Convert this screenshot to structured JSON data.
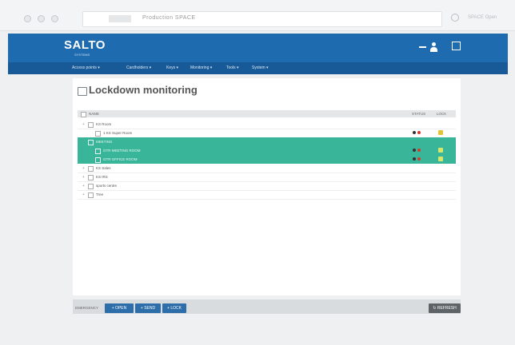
{
  "browser": {
    "url_text": "Production SPACE",
    "right_label": "SPACE Open",
    "gear_icon": "gear-icon"
  },
  "header": {
    "logo": "SALTO",
    "logo_sub": "SYSTEMS",
    "icons": [
      "minus-icon",
      "user-icon",
      "logout-icon"
    ],
    "brand_color": "#1e6bb0"
  },
  "nav": {
    "items": [
      "Access points ▾",
      "Cardholders ▾",
      "Keys ▾",
      "Monitoring ▾",
      "Tools ▾",
      "System ▾"
    ]
  },
  "page": {
    "title": "Lockdown monitoring"
  },
  "table": {
    "headers": {
      "name": "NAME",
      "status": "STATUS",
      "lock": "LOCK"
    },
    "rows": [
      {
        "label": "KS Room",
        "expand": "+",
        "indent": 0,
        "selected": false,
        "status": false,
        "lock": false
      },
      {
        "label": "1 KS Super Room",
        "expand": "",
        "indent": 1,
        "selected": false,
        "status": true,
        "lock": true
      },
      {
        "label": "MEETING",
        "expand": "-",
        "indent": 0,
        "selected": true,
        "status": false,
        "lock": false
      },
      {
        "label": "GTR MEETING ROOM",
        "expand": "",
        "indent": 1,
        "selected": true,
        "status": true,
        "lock": true
      },
      {
        "label": "GTR OFFICE ROOM",
        "expand": "",
        "indent": 1,
        "selected": true,
        "status": true,
        "lock": true
      },
      {
        "label": "KS Sales",
        "expand": "+",
        "indent": 0,
        "selected": false,
        "status": false,
        "lock": false
      },
      {
        "label": "KS IRS",
        "expand": "+",
        "indent": 0,
        "selected": false,
        "status": false,
        "lock": false
      },
      {
        "label": "sports centre",
        "expand": "+",
        "indent": 0,
        "selected": false,
        "status": false,
        "lock": false
      },
      {
        "label": "Tree",
        "expand": "+",
        "indent": 0,
        "selected": false,
        "status": false,
        "lock": false
      }
    ],
    "selected_color": "#39b59a"
  },
  "footer": {
    "label": "EMERGENCY",
    "buttons": [
      "+ OPEN",
      "+ SEND",
      "+ LOCK"
    ],
    "refresh": "↻ REFRESH"
  }
}
